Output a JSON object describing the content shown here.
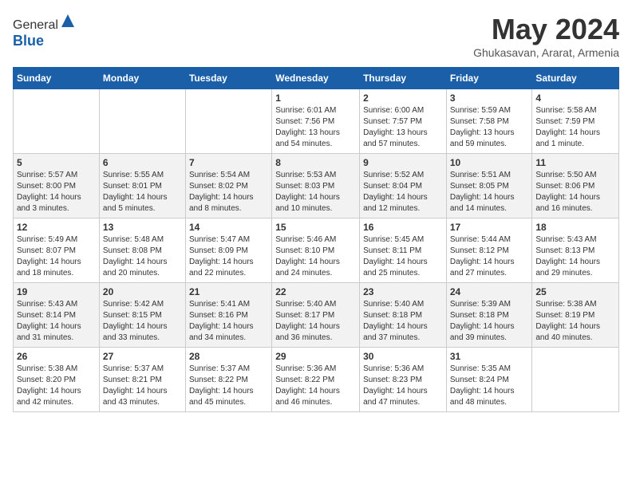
{
  "header": {
    "logo_general": "General",
    "logo_blue": "Blue",
    "month_title": "May 2024",
    "location": "Ghukasavan, Ararat, Armenia"
  },
  "days_of_week": [
    "Sunday",
    "Monday",
    "Tuesday",
    "Wednesday",
    "Thursday",
    "Friday",
    "Saturday"
  ],
  "weeks": [
    [
      {
        "day": "",
        "info": ""
      },
      {
        "day": "",
        "info": ""
      },
      {
        "day": "",
        "info": ""
      },
      {
        "day": "1",
        "info": "Sunrise: 6:01 AM\nSunset: 7:56 PM\nDaylight: 13 hours\nand 54 minutes."
      },
      {
        "day": "2",
        "info": "Sunrise: 6:00 AM\nSunset: 7:57 PM\nDaylight: 13 hours\nand 57 minutes."
      },
      {
        "day": "3",
        "info": "Sunrise: 5:59 AM\nSunset: 7:58 PM\nDaylight: 13 hours\nand 59 minutes."
      },
      {
        "day": "4",
        "info": "Sunrise: 5:58 AM\nSunset: 7:59 PM\nDaylight: 14 hours\nand 1 minute."
      }
    ],
    [
      {
        "day": "5",
        "info": "Sunrise: 5:57 AM\nSunset: 8:00 PM\nDaylight: 14 hours\nand 3 minutes."
      },
      {
        "day": "6",
        "info": "Sunrise: 5:55 AM\nSunset: 8:01 PM\nDaylight: 14 hours\nand 5 minutes."
      },
      {
        "day": "7",
        "info": "Sunrise: 5:54 AM\nSunset: 8:02 PM\nDaylight: 14 hours\nand 8 minutes."
      },
      {
        "day": "8",
        "info": "Sunrise: 5:53 AM\nSunset: 8:03 PM\nDaylight: 14 hours\nand 10 minutes."
      },
      {
        "day": "9",
        "info": "Sunrise: 5:52 AM\nSunset: 8:04 PM\nDaylight: 14 hours\nand 12 minutes."
      },
      {
        "day": "10",
        "info": "Sunrise: 5:51 AM\nSunset: 8:05 PM\nDaylight: 14 hours\nand 14 minutes."
      },
      {
        "day": "11",
        "info": "Sunrise: 5:50 AM\nSunset: 8:06 PM\nDaylight: 14 hours\nand 16 minutes."
      }
    ],
    [
      {
        "day": "12",
        "info": "Sunrise: 5:49 AM\nSunset: 8:07 PM\nDaylight: 14 hours\nand 18 minutes."
      },
      {
        "day": "13",
        "info": "Sunrise: 5:48 AM\nSunset: 8:08 PM\nDaylight: 14 hours\nand 20 minutes."
      },
      {
        "day": "14",
        "info": "Sunrise: 5:47 AM\nSunset: 8:09 PM\nDaylight: 14 hours\nand 22 minutes."
      },
      {
        "day": "15",
        "info": "Sunrise: 5:46 AM\nSunset: 8:10 PM\nDaylight: 14 hours\nand 24 minutes."
      },
      {
        "day": "16",
        "info": "Sunrise: 5:45 AM\nSunset: 8:11 PM\nDaylight: 14 hours\nand 25 minutes."
      },
      {
        "day": "17",
        "info": "Sunrise: 5:44 AM\nSunset: 8:12 PM\nDaylight: 14 hours\nand 27 minutes."
      },
      {
        "day": "18",
        "info": "Sunrise: 5:43 AM\nSunset: 8:13 PM\nDaylight: 14 hours\nand 29 minutes."
      }
    ],
    [
      {
        "day": "19",
        "info": "Sunrise: 5:43 AM\nSunset: 8:14 PM\nDaylight: 14 hours\nand 31 minutes."
      },
      {
        "day": "20",
        "info": "Sunrise: 5:42 AM\nSunset: 8:15 PM\nDaylight: 14 hours\nand 33 minutes."
      },
      {
        "day": "21",
        "info": "Sunrise: 5:41 AM\nSunset: 8:16 PM\nDaylight: 14 hours\nand 34 minutes."
      },
      {
        "day": "22",
        "info": "Sunrise: 5:40 AM\nSunset: 8:17 PM\nDaylight: 14 hours\nand 36 minutes."
      },
      {
        "day": "23",
        "info": "Sunrise: 5:40 AM\nSunset: 8:18 PM\nDaylight: 14 hours\nand 37 minutes."
      },
      {
        "day": "24",
        "info": "Sunrise: 5:39 AM\nSunset: 8:18 PM\nDaylight: 14 hours\nand 39 minutes."
      },
      {
        "day": "25",
        "info": "Sunrise: 5:38 AM\nSunset: 8:19 PM\nDaylight: 14 hours\nand 40 minutes."
      }
    ],
    [
      {
        "day": "26",
        "info": "Sunrise: 5:38 AM\nSunset: 8:20 PM\nDaylight: 14 hours\nand 42 minutes."
      },
      {
        "day": "27",
        "info": "Sunrise: 5:37 AM\nSunset: 8:21 PM\nDaylight: 14 hours\nand 43 minutes."
      },
      {
        "day": "28",
        "info": "Sunrise: 5:37 AM\nSunset: 8:22 PM\nDaylight: 14 hours\nand 45 minutes."
      },
      {
        "day": "29",
        "info": "Sunrise: 5:36 AM\nSunset: 8:22 PM\nDaylight: 14 hours\nand 46 minutes."
      },
      {
        "day": "30",
        "info": "Sunrise: 5:36 AM\nSunset: 8:23 PM\nDaylight: 14 hours\nand 47 minutes."
      },
      {
        "day": "31",
        "info": "Sunrise: 5:35 AM\nSunset: 8:24 PM\nDaylight: 14 hours\nand 48 minutes."
      },
      {
        "day": "",
        "info": ""
      }
    ]
  ]
}
